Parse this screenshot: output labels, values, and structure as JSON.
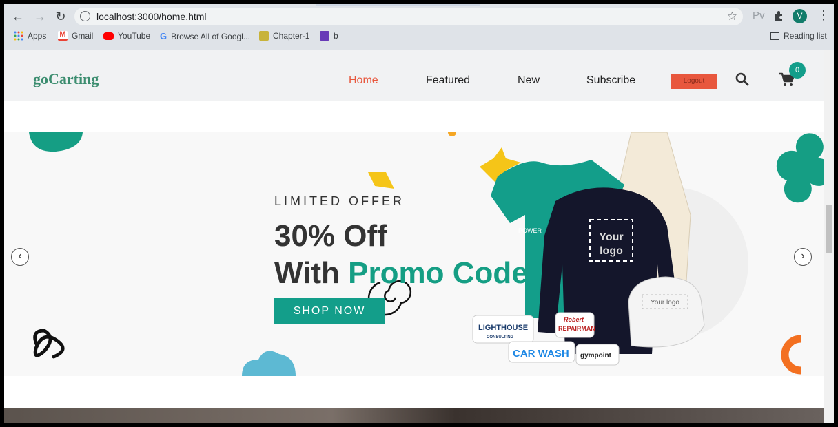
{
  "browser": {
    "url": "localhost:3000/home.html",
    "profile_initial": "V",
    "ext_label": "Pv",
    "bookmarks": [
      {
        "label": "Apps"
      },
      {
        "label": "Gmail"
      },
      {
        "label": "YouTube"
      },
      {
        "label": "Browse All of Googl..."
      },
      {
        "label": "Chapter-1"
      },
      {
        "label": "b"
      }
    ],
    "reading_list": "Reading list"
  },
  "site": {
    "logo": "goCarting",
    "nav": [
      {
        "label": "Home",
        "active": true
      },
      {
        "label": "Featured"
      },
      {
        "label": "New"
      },
      {
        "label": "Subscribe"
      }
    ],
    "logout_label": "Logout",
    "cart_count": "0"
  },
  "hero": {
    "eyebrow": "LIMITED OFFER",
    "headline_line1": "30% Off",
    "headline_line2_prefix": "With ",
    "headline_line2_accent": "Promo Code",
    "cta_label": "SHOP NOW",
    "tshirt_brand": "POWER",
    "sweatshirt_logo_line1": "Your",
    "sweatshirt_logo_line2": "logo",
    "cap_logo": "Your logo",
    "stickers": [
      "LIGHTHOUSE",
      "CONSULTING",
      "Robert",
      "REPAIRMAN",
      "CAR WASH",
      "gympoint"
    ]
  },
  "colors": {
    "accent": "#139e8a",
    "logout": "#e8573d",
    "active_nav": "#e8573d"
  }
}
